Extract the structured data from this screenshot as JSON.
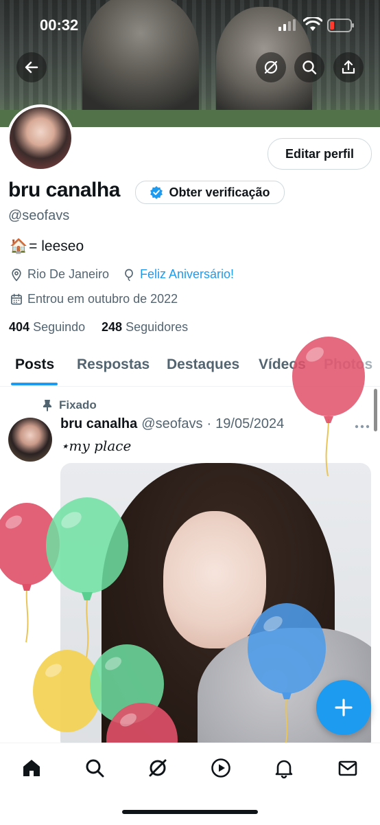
{
  "status_bar": {
    "time": "00:32"
  },
  "profile": {
    "edit_label": "Editar perfil",
    "display_name": "bru canalha",
    "verify_label": "Obter verificação",
    "handle": "@seofavs",
    "bio_emoji": "🏠",
    "bio_text": "= leeseo",
    "location": "Rio De Janeiro",
    "birthday_text": "Feliz Aniversário!",
    "joined": "Entrou em outubro de 2022",
    "following_count": "404",
    "following_label": "Seguindo",
    "followers_count": "248",
    "followers_label": "Seguidores"
  },
  "tabs": [
    {
      "label": "Posts"
    },
    {
      "label": "Respostas"
    },
    {
      "label": "Destaques"
    },
    {
      "label": "Vídeos"
    },
    {
      "label": "Photos"
    }
  ],
  "post": {
    "pinned_label": "Fixado",
    "author_name": "bru canalha",
    "author_handle": "@seofavs",
    "separator": "·",
    "date": "19/05/2024",
    "text": "⋆my place"
  },
  "icons": {
    "back": "arrow-left-icon",
    "grok": "grok-icon",
    "search": "search-icon",
    "share": "share-icon",
    "location": "location-pin-icon",
    "birthday": "balloon-icon",
    "calendar": "calendar-icon",
    "pin": "pin-icon",
    "more": "more-dots-icon",
    "compose": "plus-icon",
    "nav": [
      "home-icon",
      "search-icon",
      "grok-icon",
      "play-icon",
      "bell-icon",
      "mail-icon"
    ]
  },
  "colors": {
    "accent": "#1d9bf0",
    "text": "#0f1419",
    "secondary": "#536471"
  }
}
